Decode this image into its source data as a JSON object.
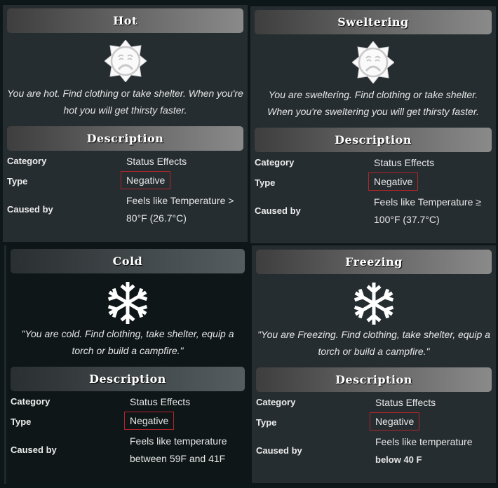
{
  "panels": [
    {
      "id": "hot",
      "title": "Hot",
      "icon": "sad-sun-icon",
      "quote": "You are hot. Find clothing or take shelter. When you're hot you will get thirsty faster.",
      "description_header": "Description",
      "rows": {
        "category_label": "Category",
        "category_value": "Status Effects",
        "type_label": "Type",
        "type_value": "Negative",
        "caused_label": "Caused by",
        "caused_line1": "Feels like Temperature >",
        "caused_line2": "80°F (26.7°C)"
      }
    },
    {
      "id": "sweltering",
      "title": "Sweltering",
      "icon": "sad-sun-icon",
      "quote": "You are sweltering. Find clothing or take shelter. When you're sweltering you will get thirsty faster.",
      "description_header": "Description",
      "rows": {
        "category_label": "Category",
        "category_value": "Status Effects",
        "type_label": "Type",
        "type_value": "Negative",
        "caused_label": "Caused by",
        "caused_line1": "Feels like Temperature ≥",
        "caused_line2": "100°F (37.7°C)"
      }
    },
    {
      "id": "cold",
      "title": "Cold",
      "icon": "snowflake-icon",
      "quote": "\"You are cold. Find clothing, take shelter, equip a torch or build a campfire.\"",
      "description_header": "Description",
      "rows": {
        "category_label": "Category",
        "category_value": "Status Effects",
        "type_label": "Type",
        "type_value": "Negative",
        "caused_label": "Caused by",
        "caused_line1": "Feels like temperature",
        "caused_line2": "between 59F and 41F"
      }
    },
    {
      "id": "freezing",
      "title": "Freezing",
      "icon": "snowflake-icon",
      "quote": "\"You are Freezing. Find clothing, take shelter, equip a torch or build a campfire.\"",
      "description_header": "Description",
      "rows": {
        "category_label": "Category",
        "category_value": "Status Effects",
        "type_label": "Type",
        "type_value": "Negative",
        "caused_label": "Caused by",
        "caused_line1": "Feels like temperature",
        "caused_line2": "below 40 F"
      }
    }
  ],
  "colors": {
    "highlight_box": "#b0262c",
    "panel_bg": "#262d30",
    "panel_bg_dark": "#0e1617"
  }
}
